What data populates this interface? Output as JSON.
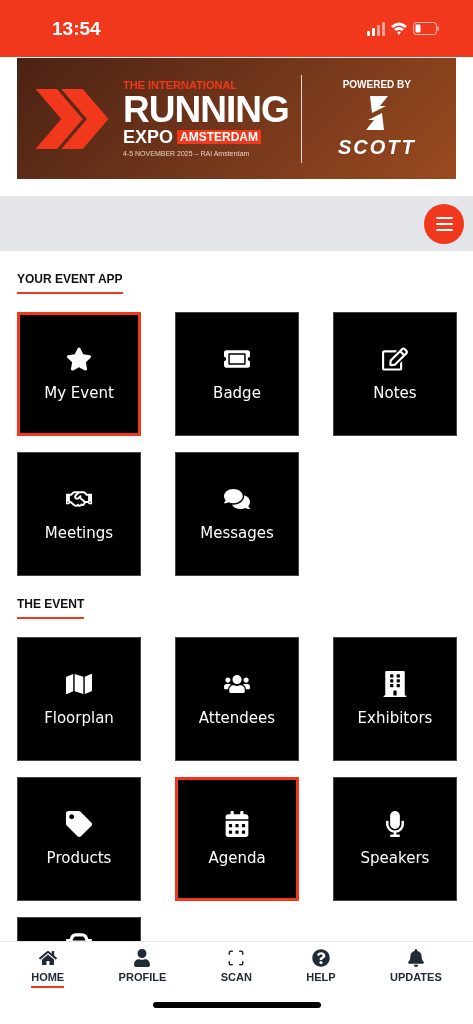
{
  "status_bar": {
    "time": "13:54"
  },
  "banner": {
    "overline": "THE INTERNATIONAL",
    "title": "RUNNING",
    "subtitle": "EXPO",
    "city": "AMSTERDAM",
    "dates": "4-5 NOVEMBER 2025 – RAI Amsterdam",
    "sponsor_label": "POWERED BY",
    "sponsor": "SCOTT"
  },
  "sections": [
    {
      "title": "YOUR EVENT APP",
      "tiles": [
        {
          "kind": "star",
          "label": "My Event",
          "selected": true
        },
        {
          "kind": "ticket",
          "label": "Badge",
          "selected": false
        },
        {
          "kind": "edit",
          "label": "Notes",
          "selected": false
        },
        {
          "kind": "handshake",
          "label": "Meetings",
          "selected": false
        },
        {
          "kind": "chat",
          "label": "Messages",
          "selected": false
        }
      ]
    },
    {
      "title": "THE EVENT",
      "tiles": [
        {
          "kind": "map",
          "label": "Floorplan",
          "selected": false
        },
        {
          "kind": "users",
          "label": "Attendees",
          "selected": false
        },
        {
          "kind": "building",
          "label": "Exhibitors",
          "selected": false
        },
        {
          "kind": "tag",
          "label": "Products",
          "selected": false
        },
        {
          "kind": "calendar",
          "label": "Agenda",
          "selected": true
        },
        {
          "kind": "mic",
          "label": "Speakers",
          "selected": false
        },
        {
          "kind": "car",
          "selected": false
        }
      ]
    }
  ],
  "nav": [
    {
      "kind": "home",
      "label": "HOME",
      "selected": true
    },
    {
      "kind": "user",
      "label": "PROFILE",
      "selected": false
    },
    {
      "kind": "scan",
      "label": "SCAN",
      "selected": false
    },
    {
      "kind": "help",
      "label": "HELP",
      "selected": false
    },
    {
      "kind": "bell",
      "label": "UPDATES",
      "selected": false
    }
  ]
}
